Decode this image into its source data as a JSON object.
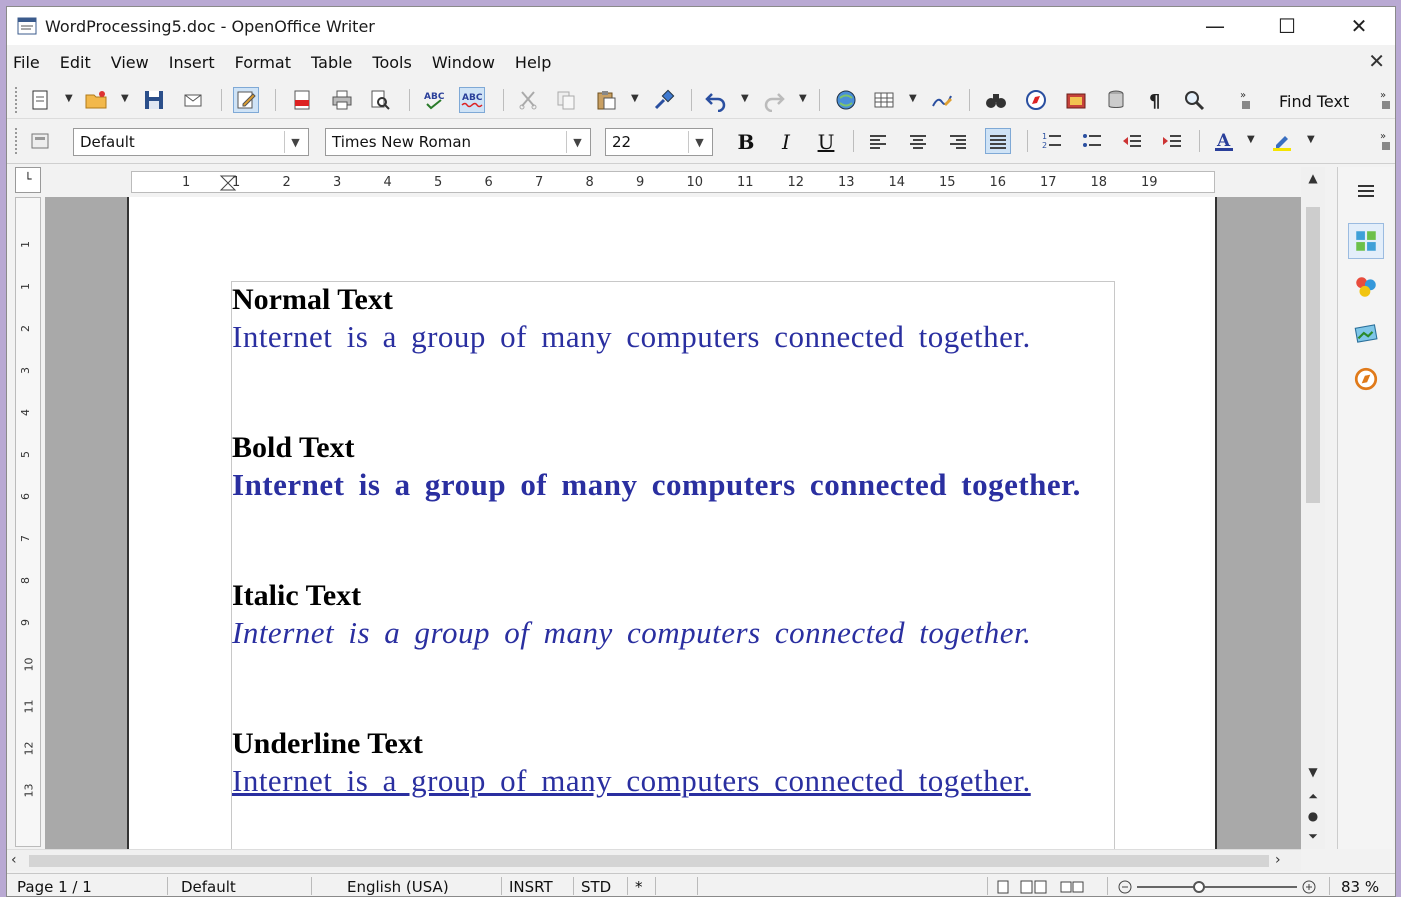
{
  "window": {
    "title": "WordProcessing5.doc - OpenOffice Writer",
    "controls": {
      "minimize": "—",
      "maximize": "☐",
      "close": "✕"
    }
  },
  "menu": [
    "File",
    "Edit",
    "View",
    "Insert",
    "Format",
    "Table",
    "Tools",
    "Window",
    "Help"
  ],
  "menu_close": "✕",
  "toolbar_standard": {
    "find_text_label": "Find Text"
  },
  "toolbar_formatting": {
    "paragraph_style": "Default",
    "font_name": "Times New Roman",
    "font_size": "22",
    "bold_label": "B",
    "italic_label": "I",
    "underline_label": "U"
  },
  "ruler": {
    "ticks": [
      "1",
      "1",
      "2",
      "3",
      "4",
      "5",
      "6",
      "7",
      "8",
      "9",
      "10",
      "11",
      "12",
      "13",
      "14",
      "15",
      "16",
      "17",
      "18",
      "19"
    ],
    "vticks": [
      "1",
      "1",
      "2",
      "3",
      "4",
      "5",
      "6",
      "7",
      "8",
      "9",
      "10",
      "11",
      "12",
      "13"
    ]
  },
  "document": {
    "sections": [
      {
        "heading": "Normal Text",
        "body": "Internet is a group of many computers connected together.",
        "style": "normal"
      },
      {
        "heading": "Bold Text",
        "body": "Internet is a group of many computers connected together.",
        "style": "bold"
      },
      {
        "heading": "Italic Text",
        "body": "Internet is a group of many computers connected together.",
        "style": "italic"
      },
      {
        "heading": "Underline Text",
        "body": "Internet is a group of many computers connected together.",
        "style": "underline"
      }
    ],
    "text_color": "#2a2fa0"
  },
  "statusbar": {
    "page": "Page 1 / 1",
    "page_style": "Default",
    "language": "English (USA)",
    "insert_mode": "INSRT",
    "selection_mode": "STD",
    "modified": "*",
    "zoom": "83 %"
  }
}
